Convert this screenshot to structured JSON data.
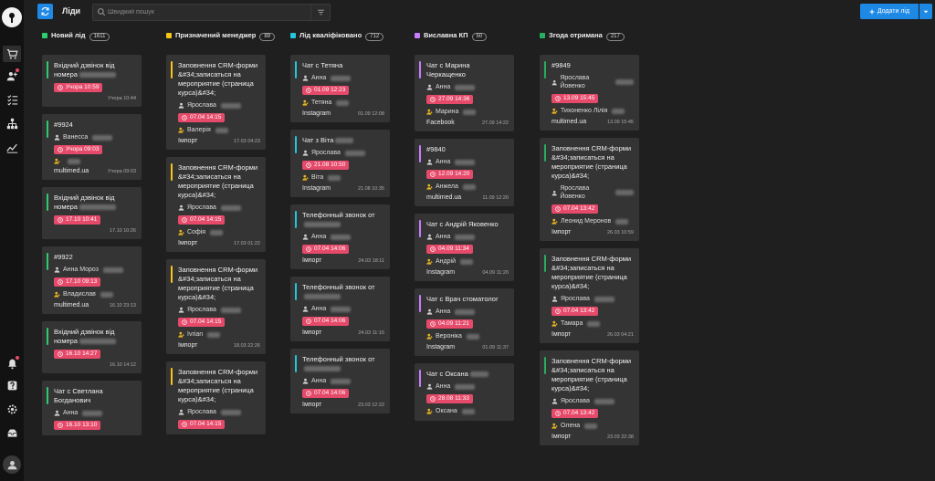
{
  "page": {
    "title": "Ліди"
  },
  "search": {
    "placeholder": "Швидкий пошук"
  },
  "add_button": {
    "label": "Додати лід"
  },
  "colors": {
    "accent": "#1e88e5",
    "badge": "#e64a6a",
    "green": "#2ecc71",
    "yellow": "#f5c518",
    "cyan": "#26c6da",
    "violet": "#c77dff",
    "dark_green": "#27ae60"
  },
  "sidebar": {
    "items": [
      {
        "icon": "cart-icon",
        "active": true,
        "dot": false
      },
      {
        "icon": "user-add-icon",
        "active": false,
        "dot": true
      },
      {
        "icon": "checklist-icon",
        "active": false,
        "dot": false
      },
      {
        "icon": "org-chart-icon",
        "active": false,
        "dot": false
      },
      {
        "icon": "analytics-icon",
        "active": false,
        "dot": false
      },
      {
        "icon": "bell-icon",
        "active": false,
        "dot": true
      },
      {
        "icon": "help-icon",
        "active": false,
        "dot": false
      },
      {
        "icon": "settings-icon",
        "active": false,
        "dot": false
      },
      {
        "icon": "inbox-icon",
        "active": false,
        "dot": false
      }
    ]
  },
  "columns": [
    {
      "title": "Новий лід",
      "count": "1611",
      "color": "#2ecc71",
      "cards": [
        {
          "title": "Вхідний дзвінок від номера",
          "title_blur": 40,
          "contact": "",
          "badge": "Учора 10:59",
          "manager": "",
          "source": "",
          "ts": "Учора 10:44"
        },
        {
          "title": "#9924",
          "title_blur": 0,
          "contact": "Ванесса",
          "badge": "Учора 09:03",
          "manager": " ",
          "source": "multimed.ua",
          "ts": "Учора 09:03"
        },
        {
          "title": "Вхідний дзвінок від номера",
          "title_blur": 40,
          "contact": "",
          "badge": "17.10 10:41",
          "manager": "",
          "source": "",
          "ts": "17.10 10:26"
        },
        {
          "title": "#9922",
          "title_blur": 0,
          "contact": "Анна Мороз",
          "badge": "17.10 09:13",
          "manager": "Владислав",
          "source": "multimed.ua",
          "ts": "16.10 23:13"
        },
        {
          "title": "Вхідний дзвінок від номера",
          "title_blur": 40,
          "contact": "",
          "badge": "16.10 14:27",
          "manager": "",
          "source": "",
          "ts": "16.10 14:12"
        },
        {
          "title": "Чат с Светлана Богданович",
          "title_blur": 0,
          "contact": "Анна",
          "badge": "16.10 13:10",
          "manager": "",
          "source": "",
          "ts": ""
        }
      ]
    },
    {
      "title": "Призначений менеджер",
      "count": "89",
      "color": "#f5c518",
      "cards": [
        {
          "title": "Заповнення CRM-форми &#34;записаться на мероприятие (страница курса)&#34;",
          "title_blur": 0,
          "contact": "Ярослава",
          "badge": "07.04 14:15",
          "manager": "Валерія",
          "source": "Імпорт",
          "ts": "17.03 04:23"
        },
        {
          "title": "Заповнення CRM-форми &#34;записаться на мероприятие (страница курса)&#34;",
          "title_blur": 0,
          "contact": "Ярослава",
          "badge": "07.04 14:15",
          "manager": "Софія",
          "source": "Імпорт",
          "ts": "17.03 01:22"
        },
        {
          "title": "Заповнення CRM-форми &#34;записаться на мероприятие (страница курса)&#34;",
          "title_blur": 0,
          "contact": "Ярослава",
          "badge": "07.04 14:15",
          "manager": "Ivrian",
          "source": "Імпорт",
          "ts": "18.03 22:26"
        },
        {
          "title": "Заповнення CRM-форми &#34;записаться на мероприятие (страница курса)&#34;",
          "title_blur": 0,
          "contact": "Ярослава",
          "badge": "07.04 14:15",
          "manager": "",
          "source": "",
          "ts": ""
        }
      ]
    },
    {
      "title": "Лід кваліфіковано",
      "count": "712",
      "color": "#26c6da",
      "cards": [
        {
          "title": "Чат с Тетяна",
          "title_blur": 0,
          "contact": "Анна",
          "badge": "01.09 12:23",
          "manager": "Тетяна",
          "source": "Instagram",
          "ts": "01.09 12:08"
        },
        {
          "title": "Чат з Віта",
          "title_blur": 20,
          "contact": "Ярослава",
          "badge": "21.08 10:50",
          "manager": "Віта",
          "source": "Instagram",
          "ts": "21.08 10:35"
        },
        {
          "title": "Телефонный звонок от",
          "title_blur": 40,
          "contact": "Анна",
          "badge": "07.04 14:06",
          "manager": "",
          "source": "Імпорт",
          "ts": "24.03 18:11"
        },
        {
          "title": "Телефонный звонок от",
          "title_blur": 40,
          "contact": "Анна",
          "badge": "07.04 14:06",
          "manager": "",
          "source": "Імпорт",
          "ts": "24.03 11:15"
        },
        {
          "title": "Телефонный звонок от",
          "title_blur": 40,
          "contact": "Анна",
          "badge": "07.04 14:06",
          "manager": "",
          "source": "Імпорт",
          "ts": "23.03 12:22"
        }
      ]
    },
    {
      "title": "Виславна КП",
      "count": "50",
      "color": "#c77dff",
      "cards": [
        {
          "title": "Чат с Марина Черкащенко",
          "title_blur": 0,
          "contact": "Анна",
          "badge": "27.09 14:36",
          "manager": "Марина",
          "source": "Facebook",
          "ts": "27.09 14:22"
        },
        {
          "title": "#9840",
          "title_blur": 0,
          "contact": "Анна",
          "badge": "12.09 14:20",
          "manager": "Анжела",
          "source": "multimed.ua",
          "ts": "11.09 12:20"
        },
        {
          "title": "Чат с Андрій Яковенко",
          "title_blur": 0,
          "contact": "Анна",
          "badge": "04.09 11:34",
          "manager": "Андрій",
          "source": "Instagram",
          "ts": "04.09 11:20"
        },
        {
          "title": "Чат с Врач стоматолог",
          "title_blur": 0,
          "contact": "Анна",
          "badge": "04.09 11:21",
          "manager": "Вероніка",
          "source": "Instagram",
          "ts": "01.09 11:37"
        },
        {
          "title": "Чат с Оксана",
          "title_blur": 20,
          "contact": "Анна",
          "badge": "28.08 11:33",
          "manager": "Оксана",
          "source": "",
          "ts": ""
        }
      ]
    },
    {
      "title": "Згода отримана",
      "count": "217",
      "color": "#27ae60",
      "cards": [
        {
          "title": "#9849",
          "title_blur": 0,
          "contact": "Ярослава Йовенко",
          "badge": "13.09 15:45",
          "manager": "Тихоненко Лілія",
          "source": "multimed.ua",
          "ts": "13.09 15:45"
        },
        {
          "title": "Заповнення CRM-форми &#34;записаться на мероприятие (страница курса)&#34;",
          "title_blur": 0,
          "contact": "Ярослава Йовенко",
          "badge": "07.04 13:42",
          "manager": "Леонид Меронов",
          "source": "Імпорт",
          "ts": "26.03 10:59"
        },
        {
          "title": "Заповнення CRM-форми &#34;записаться на мероприятие (страница курса)&#34;",
          "title_blur": 0,
          "contact": "Ярослава",
          "badge": "07.04 13:42",
          "manager": "Тамара",
          "source": "Імпорт",
          "ts": "26.03 04:21"
        },
        {
          "title": "Заповнення CRM-форми &#34;записаться на мероприятие (страница курса)&#34;",
          "title_blur": 0,
          "contact": "Ярослава",
          "badge": "07.04 13:42",
          "manager": "Олена",
          "source": "Імпорт",
          "ts": "23.03 22:38"
        }
      ]
    }
  ]
}
